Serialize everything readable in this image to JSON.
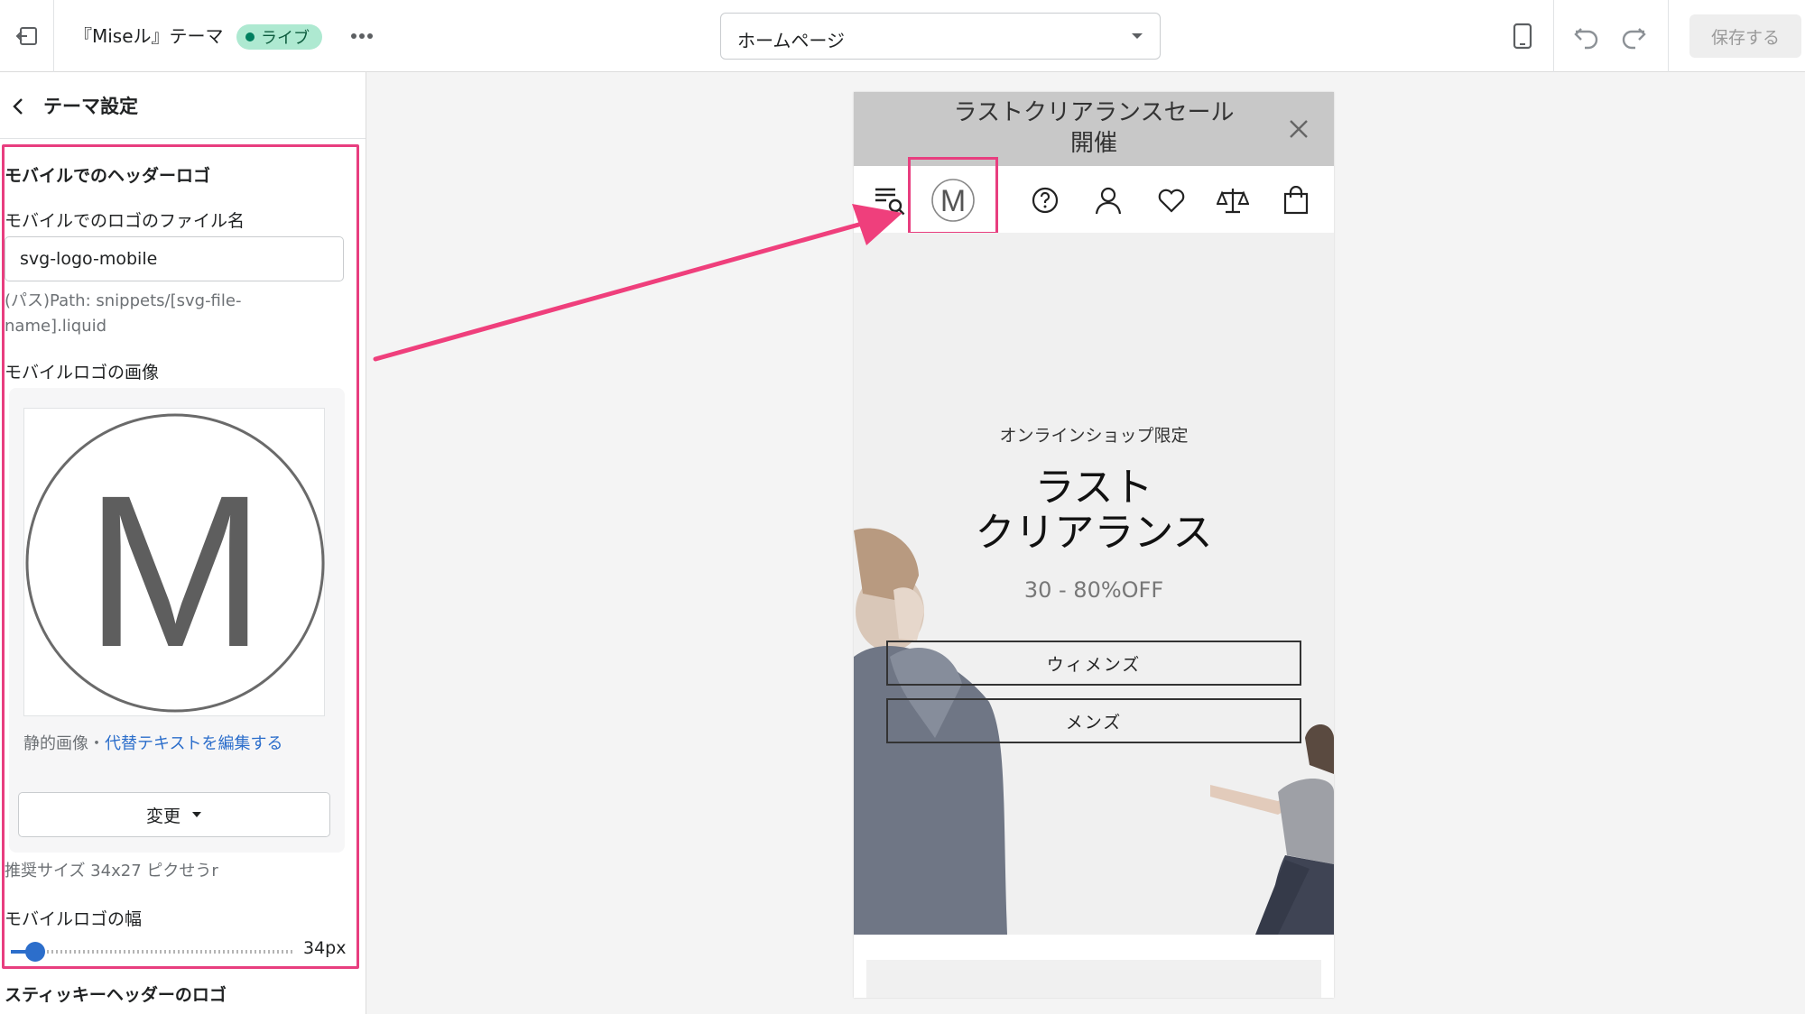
{
  "topbar": {
    "theme_name": "『Miseル』テーマ",
    "live_badge": "ライブ",
    "page_selector": "ホームページ",
    "save_label": "保存する"
  },
  "sidebar": {
    "title": "テーマ設定",
    "section_title": "モバイルでのヘッダーロゴ",
    "filename_label": "モバイルでのロゴのファイル名",
    "filename_value": "svg-logo-mobile",
    "filename_help": "(パス)Path: snippets/[svg-file-name].liquid",
    "image_label": "モバイルロゴの画像",
    "logo_letter": "M",
    "image_type": "静的画像",
    "separator": "・",
    "alt_text_link": "代替テキストを編集する",
    "change_button": "変更",
    "recommended_size": "推奨サイズ 34x27 ピクせうr",
    "width_label": "モバイルロゴの幅",
    "width_value": "34px",
    "width_fraction": 0.05,
    "next_section_title": "スティッキーヘッダーのロゴ"
  },
  "preview": {
    "announcement_line1": "ラストクリアランスセール",
    "announcement_line2": "開催",
    "logo_letter": "M",
    "hero_subtitle": "オンラインショップ限定",
    "hero_title_line1": "ラスト",
    "hero_title_line2": "クリアランス",
    "hero_discount": "30 - 80%OFF",
    "button_women": "ウィメンズ",
    "button_men": "メンズ"
  },
  "colors": {
    "highlight": "#e83e7f",
    "live_badge_bg": "#aee9d1",
    "link": "#2c6ecb"
  }
}
